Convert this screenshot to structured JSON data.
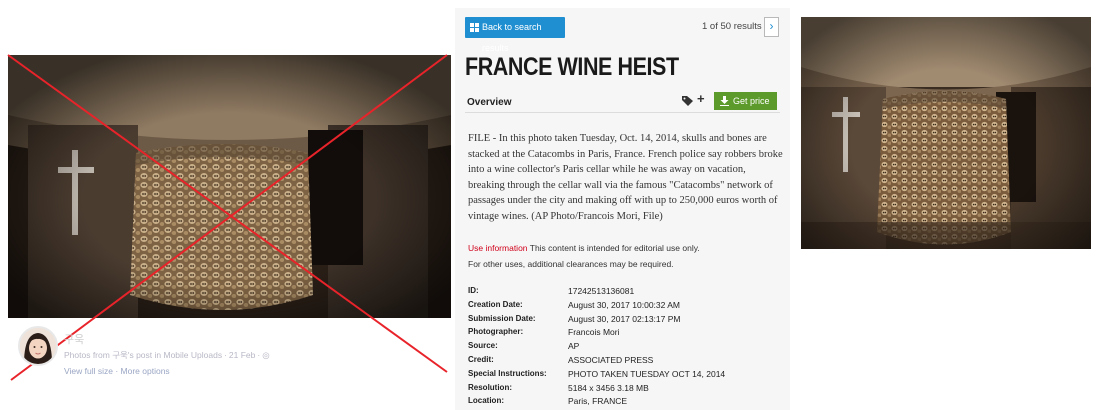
{
  "facebook": {
    "user_name": "구욱",
    "meta": {
      "prefix": "Photos from",
      "owner": "구욱's post in Mobile Uploads",
      "date": "21 Feb"
    },
    "links": {
      "view_full_size": "View full size",
      "more_options": "More options"
    }
  },
  "ap": {
    "back_label": "Back to search results",
    "results_text": "1 of 50 results",
    "next_glyph": "›",
    "headline": "FRANCE WINE HEIST",
    "overview_label": "Overview",
    "plus_glyph": "+",
    "get_price_label": "Get price",
    "caption": "FILE - In this photo taken Tuesday, Oct. 14, 2014, skulls and bones are stacked at the Catacombs in Paris, France. French police say robbers broke into a wine collector's Paris cellar while he was away on vacation, breaking through the cellar wall via the famous \"Catacombs\" network of passages under the city and making off with up to 250,000 euros worth of vintage wines. (AP Photo/Francois Mori, File)",
    "usage": {
      "use_info_label": "Use information",
      "editorial_text": "This content is intended for editorial use only.",
      "other_uses_text": "For other uses, additional clearances may be required."
    },
    "metadata": [
      {
        "key": "ID:",
        "value": "17242513136081"
      },
      {
        "key": "Creation Date:",
        "value": "August 30, 2017 10:00:32 AM"
      },
      {
        "key": "Submission Date:",
        "value": "August 30, 2017 02:13:17 PM"
      },
      {
        "key": "Photographer:",
        "value": "Francois Mori"
      },
      {
        "key": "Source:",
        "value": "AP"
      },
      {
        "key": "Credit:",
        "value": "ASSOCIATED PRESS"
      },
      {
        "key": "Special Instructions:",
        "value": "PHOTO TAKEN TUESDAY OCT 14, 2014"
      },
      {
        "key": "Resolution:",
        "value": "5184 x 3456 3.18 MB"
      },
      {
        "key": "Location:",
        "value": "Paris, FRANCE"
      }
    ]
  },
  "colors": {
    "ap_blue": "#1f8fd1",
    "price_green": "#5c9a2b",
    "use_info_red": "#d0021b",
    "cross_red": "#e8232a"
  },
  "icons": [
    "grid-icon",
    "chevron-right-icon",
    "tag-icon",
    "plus-icon",
    "download-icon",
    "red-cross-mark-icon"
  ]
}
